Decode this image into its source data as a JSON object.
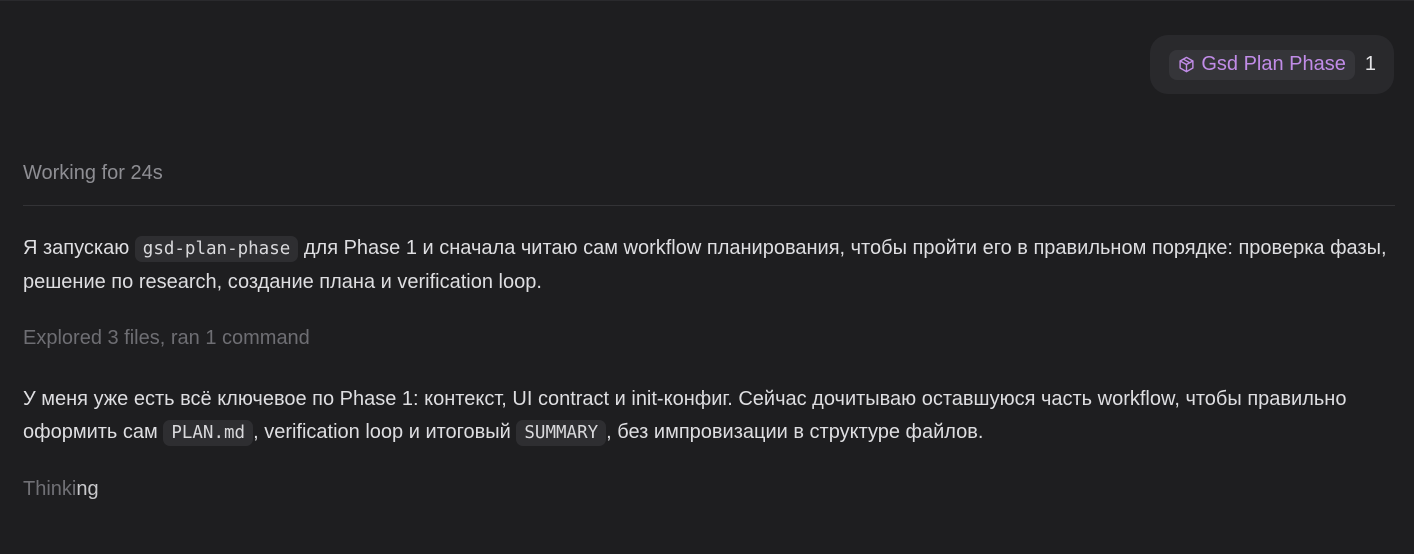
{
  "user_message": {
    "skill_chip": {
      "icon": "cube-icon",
      "label": "Gsd Plan Phase",
      "color": "#c18ce8"
    },
    "text": "1"
  },
  "status": {
    "working": "Working for 24s"
  },
  "assistant": {
    "para1": {
      "t1": "Я запускаю ",
      "code1": "gsd-plan-phase",
      "t2": " для Phase 1 и сначала читаю сам workflow планирования, чтобы пройти его в правильном порядке: проверка фазы, решение по research, создание плана и verification loop."
    },
    "explored": "Explored 3 files, ran 1 command",
    "para2": {
      "t1": "У меня уже есть всё ключевое по Phase 1: контекст, UI contract и init-конфиг. Сейчас дочитываю оставшуюся часть workflow, чтобы правильно оформить сам ",
      "code1": "PLAN.md",
      "t2": ", verification loop и итоговый ",
      "code2": "SUMMARY",
      "t3": ", без импровизации в структуре файлов."
    },
    "thinking": {
      "dim": "Thinki",
      "bright": "ng"
    }
  }
}
